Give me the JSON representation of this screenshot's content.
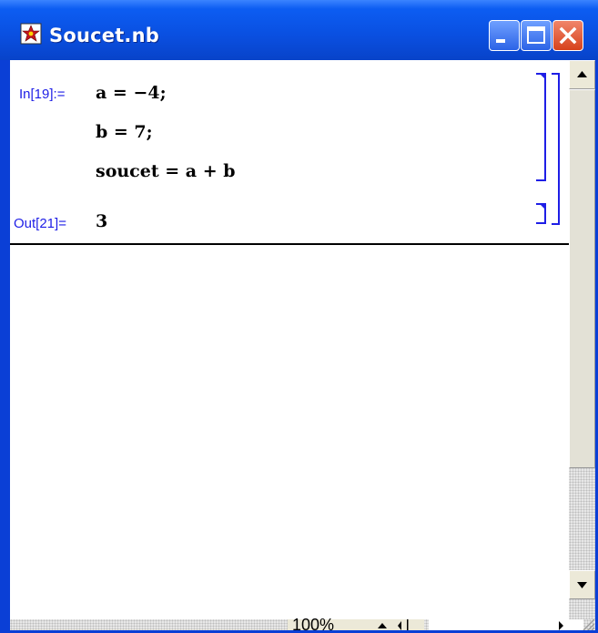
{
  "window": {
    "title": "Soucet.nb",
    "controls": [
      "minimize-icon",
      "maximize-icon",
      "close-icon"
    ]
  },
  "notebook": {
    "input_label": "In[19]:=",
    "input_lines": [
      "a = −4;",
      "b = 7;",
      "soucet = a + b"
    ],
    "output_label": "Out[21]=",
    "output_value": "3"
  },
  "status": {
    "zoom": "100%"
  },
  "colors": {
    "titlebar": "#0a4fe0",
    "label": "#1e1ee6",
    "bracket": "#1e1ee6",
    "close_button": "#d7421c"
  }
}
